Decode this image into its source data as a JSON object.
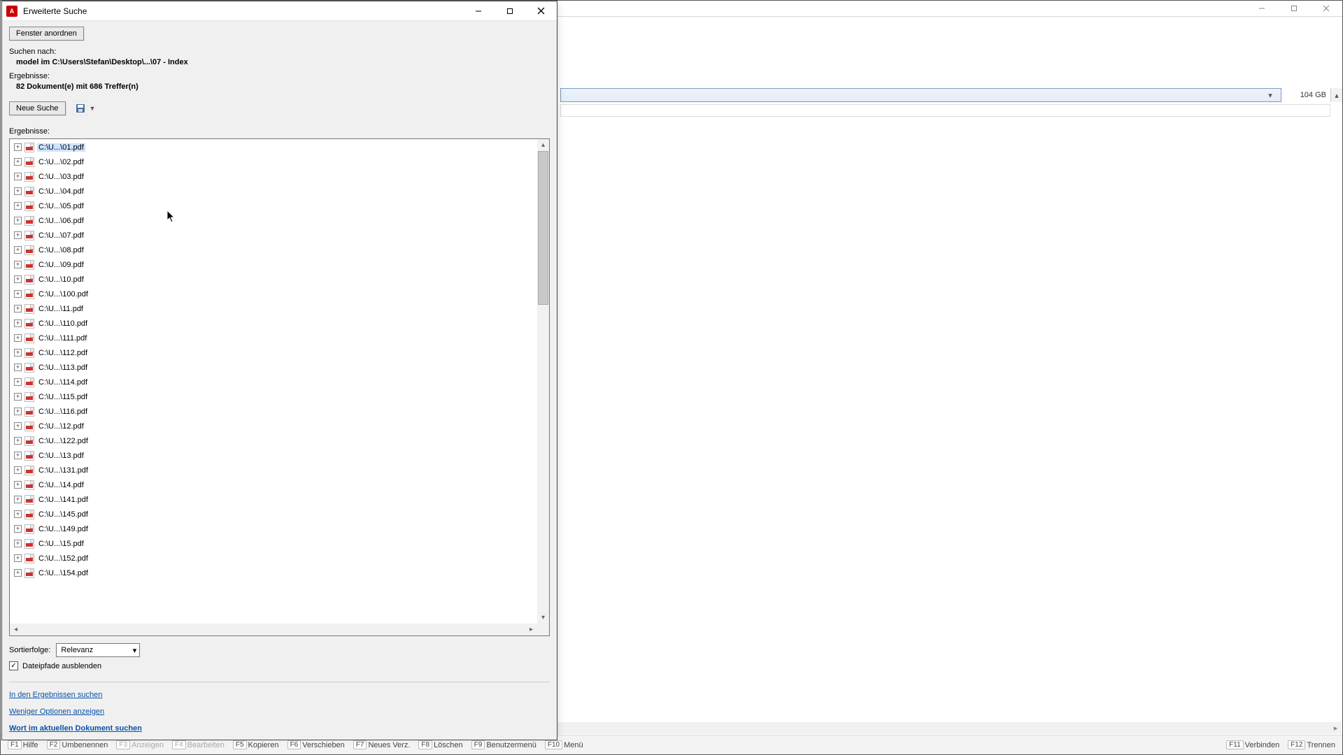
{
  "bg": {
    "size_label": "104 GB",
    "fkeys": {
      "f1": "Hilfe",
      "f2": "Umbenennen",
      "f3": "Anzeigen",
      "f4": "Bearbeiten",
      "f5": "Kopieren",
      "f6": "Verschieben",
      "f7": "Neues Verz.",
      "f8": "Löschen",
      "f9": "Benutzermenü",
      "f10": "Menü",
      "f11": "Verbinden",
      "f12": "Trennen"
    }
  },
  "fg": {
    "title": "Erweiterte Suche",
    "arrange_windows": "Fenster anordnen",
    "search_for_label": "Suchen nach:",
    "search_for_value": "model im C:\\Users\\Stefan\\Desktop\\...\\07 - Index",
    "results_header": "Ergebnisse:",
    "results_summary": "82 Dokument(e) mit 686 Treffer(n)",
    "new_search": "Neue Suche",
    "results_label": "Ergebnisse:",
    "sort_label": "Sortierfolge:",
    "sort_value": "Relevanz",
    "cb_hide_paths": "Dateipfade ausblenden",
    "link_search_in": "In den Ergebnissen suchen",
    "link_less_options": "Weniger Optionen anzeigen",
    "link_current_doc": "Wort im aktuellen Dokument suchen"
  },
  "results": [
    "C:\\U...\\01.pdf",
    "C:\\U...\\02.pdf",
    "C:\\U...\\03.pdf",
    "C:\\U...\\04.pdf",
    "C:\\U...\\05.pdf",
    "C:\\U...\\06.pdf",
    "C:\\U...\\07.pdf",
    "C:\\U...\\08.pdf",
    "C:\\U...\\09.pdf",
    "C:\\U...\\10.pdf",
    "C:\\U...\\100.pdf",
    "C:\\U...\\11.pdf",
    "C:\\U...\\110.pdf",
    "C:\\U...\\111.pdf",
    "C:\\U...\\112.pdf",
    "C:\\U...\\113.pdf",
    "C:\\U...\\114.pdf",
    "C:\\U...\\115.pdf",
    "C:\\U...\\116.pdf",
    "C:\\U...\\12.pdf",
    "C:\\U...\\122.pdf",
    "C:\\U...\\13.pdf",
    "C:\\U...\\131.pdf",
    "C:\\U...\\14.pdf",
    "C:\\U...\\141.pdf",
    "C:\\U...\\145.pdf",
    "C:\\U...\\149.pdf",
    "C:\\U...\\15.pdf",
    "C:\\U...\\152.pdf",
    "C:\\U...\\154.pdf"
  ]
}
